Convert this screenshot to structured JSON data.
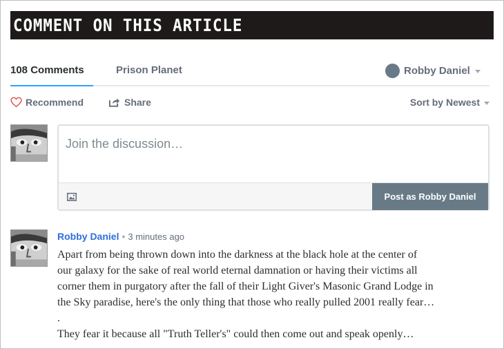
{
  "banner": {
    "title": "COMMENT ON THIS ARTICLE"
  },
  "tabs": {
    "comments_label": "108 Comments",
    "community_label": "Prison Planet"
  },
  "user_menu": {
    "name": "Robby Daniel"
  },
  "actions": {
    "recommend_label": "Recommend",
    "share_label": "Share",
    "sort_label": "Sort by Newest"
  },
  "composer": {
    "placeholder": "Join the discussion…",
    "post_label": "Post as Robby Daniel"
  },
  "comment": {
    "author": "Robby Daniel",
    "separator": "•",
    "time": "3 minutes ago",
    "lines": [
      "Apart from being thrown down into the darkness at the black hole at the center of",
      "our galaxy for the sake of real world eternal damnation or having their victims all",
      "corner them in purgatory after the fall of their Light Giver's Masonic Grand Lodge in",
      "the Sky paradise, here's the only thing that those who really pulled 2001 really fear…",
      ".",
      "They fear it because all \"Truth Teller's\" could then come out and speak openly…"
    ]
  },
  "colors": {
    "banner_bg": "#1e1a1a",
    "accent_blue": "#2e9fff",
    "author_link": "#2e6fdb",
    "button_bg": "#687a86",
    "heart": "#e24b4b"
  },
  "icons": {
    "recommend": "heart-icon",
    "share": "share-icon",
    "attach": "image-icon",
    "caret": "chevron-down-icon"
  }
}
